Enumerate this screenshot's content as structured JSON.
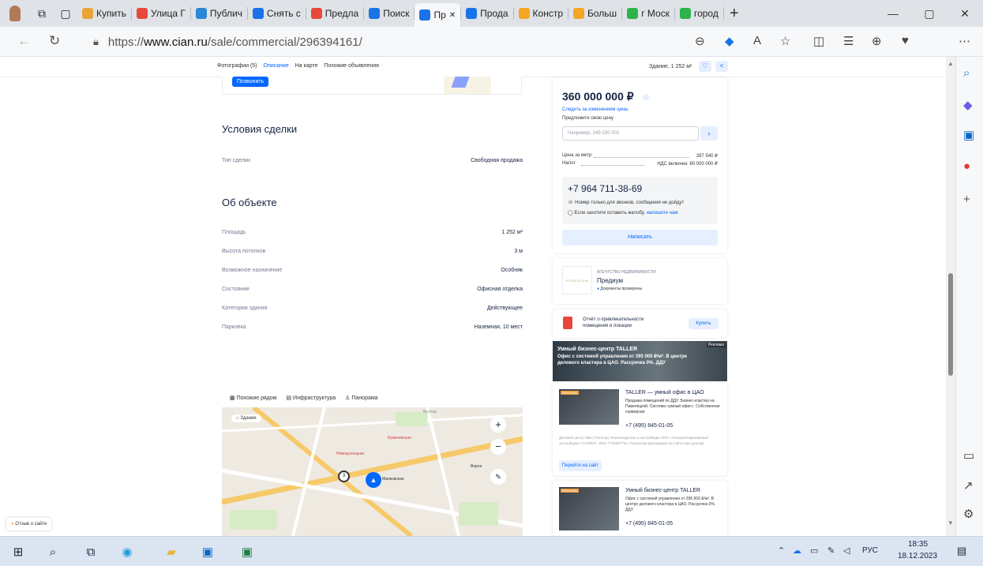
{
  "browser": {
    "tabs": [
      {
        "label": "Купить",
        "color": "#e8a53a"
      },
      {
        "label": "Улица Г",
        "color": "#e84a3a"
      },
      {
        "label": "Публич",
        "color": "#2a88d8"
      },
      {
        "label": "Снять с",
        "color": "#1a73e8"
      },
      {
        "label": "Предла",
        "color": "#e84a3a"
      },
      {
        "label": "Поиск",
        "color": "#1a73e8"
      },
      {
        "label": "Пр",
        "color": "#1a73e8",
        "active": true
      },
      {
        "label": "Прода",
        "color": "#1a73e8"
      },
      {
        "label": "Констр",
        "color": "#f5a623"
      },
      {
        "label": "Больш",
        "color": "#f5a623"
      },
      {
        "label": "г Моск",
        "color": "#2db34a"
      },
      {
        "label": "город",
        "color": "#2db34a"
      }
    ],
    "new_tab": "+",
    "url_scheme": "https://",
    "url_host": "www.cian.ru",
    "url_path": "/sale/commercial/296394161/"
  },
  "page": {
    "sticky_nav": [
      "Фотографии (5)",
      "Описание",
      "На карте",
      "Похожие объявления"
    ],
    "sticky_right": "Здание, 1 252 м²",
    "call_button": "Позвонить",
    "deal_title": "Условия сделки",
    "deal_rows": [
      {
        "label": "Тип сделки",
        "value": "Свободная продажа"
      }
    ],
    "object_title": "Об объекте",
    "object_rows": [
      {
        "label": "Площадь",
        "value": "1 252 м²"
      },
      {
        "label": "Высота потолков",
        "value": "3 м"
      },
      {
        "label": "Возможное назначение",
        "value": "Особняк"
      },
      {
        "label": "Состояние",
        "value": "Офисная отделка"
      },
      {
        "label": "Категория здания",
        "value": "Действующее"
      },
      {
        "label": "Парковка",
        "value": "Наземная, 10 мест"
      }
    ],
    "map_tabs": [
      "Похожие рядом",
      "Инфраструктура",
      "Панорама"
    ],
    "map_label": "Здание",
    "map_places": [
      "Мухтар",
      "Кумачевская",
      "Новокузнецкая",
      "Маяковская",
      "Ворон"
    ],
    "feedback": "Отзыв о сайте"
  },
  "price_card": {
    "price": "360 000 000 ₽",
    "follow_price": "Следить за изменением цены",
    "offer_label": "Предложите свою цену",
    "offer_placeholder": "Например, 349 200 000",
    "price_per_m_label": "Цена за метр",
    "price_per_m": "287 540 ₽",
    "tax_label": "Налог",
    "tax_value": "НДС включен: 60 000 000 ₽",
    "phone": "+7 964 711-38-69",
    "phone_note": "Номер только для звонков, сообщения не дойдут",
    "complaint_text": "Если захотите оставить жалобу,",
    "complaint_link": "напишите нам",
    "write_button": "Написать"
  },
  "agency": {
    "caption": "АГЕНТСТВО НЕДВИЖИМОСТИ",
    "name": "Предиум",
    "verified": "Документы проверены",
    "logo_text": "PRAEDIUM"
  },
  "report": {
    "text": "Отчёт о привлекательности помещения и локации",
    "button": "Купить"
  },
  "ads": {
    "banner_label": "Реклама",
    "banner_title": "Умный бизнес-центр TALLER",
    "banner_text": "Офис с системой управления от 395 000 ₽/м². В центре делового кластера в ЦАО. Рассрочка 0%. ДДУ",
    "ad1_title": "TALLER — умный офис в ЦАО",
    "ad1_text": "Продажа помещений по ДДУ. Бизнес-кластер на Павелецкой. Система «умный офис». Собственная серверная",
    "ad1_phone": "+7 (495) 845-01-05",
    "ad1_legal": "Деловой центр Taller (Таллер). Рекламодатель и застройщик ООО «Специализированный застройщик «ТАЛЛЕР». ИНН 7716687724. Проектная декларация на сайте наш.дом.рф.",
    "ad1_button": "Перейти на сайт",
    "ad2_title": "Умный бизнес-центр TALLER",
    "ad2_text": "Офис с системой управления от 395 000 ₽/м². В центре делового кластера в ЦАО. Рассрочка 0%. ДДУ",
    "ad2_phone": "+7 (495) 845-01-05",
    "ad_badge": "РЕКЛАМА"
  },
  "taskbar": {
    "language": "РУС",
    "time": "18:35",
    "date": "18.12.2023"
  }
}
